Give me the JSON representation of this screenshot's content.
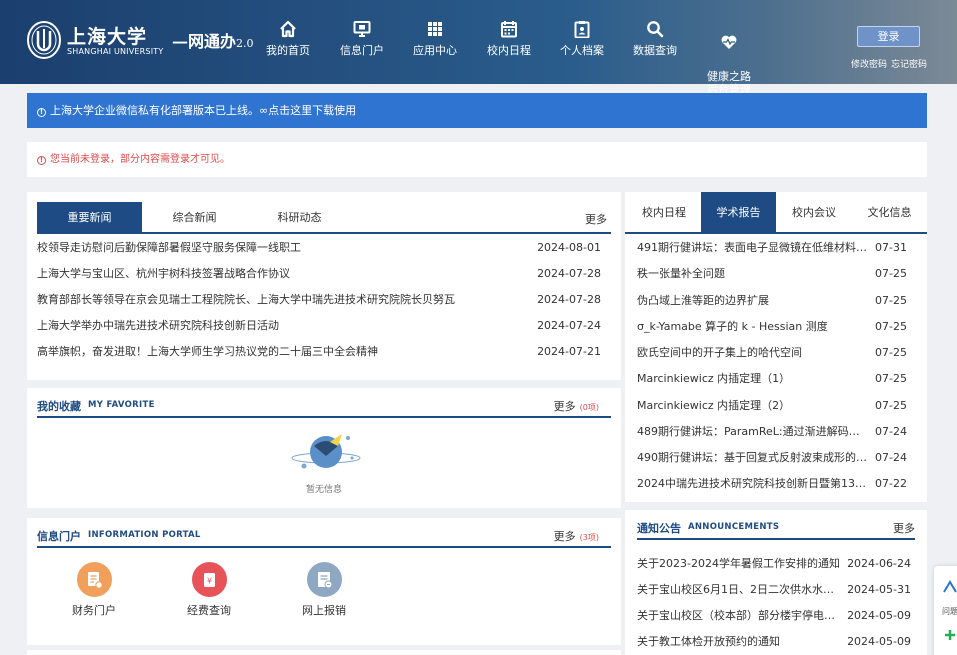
{
  "header": {
    "brand_cn": "上海大学",
    "brand_en": "SHANGHAI UNIVERSITY",
    "brand_sub": "—网通办",
    "brand_ver": "2.0",
    "nav": [
      {
        "label": "我的首页",
        "icon": "home-icon"
      },
      {
        "label": "信息门户",
        "icon": "monitor-icon"
      },
      {
        "label": "应用中心",
        "icon": "grid-icon"
      },
      {
        "label": "校内日程",
        "icon": "calendar-icon"
      },
      {
        "label": "个人档案",
        "icon": "clipboard-icon"
      },
      {
        "label": "数据查询",
        "icon": "search-icon"
      },
      {
        "label": "健康之路\n后台管理",
        "icon": "heart-icon"
      }
    ],
    "login": "登录",
    "change_password": "修改密码",
    "forgot_password": "忘记密码"
  },
  "notices": {
    "blue": "上海大学企业微信私有化部署版本已上线。",
    "blue_link": "点击这里下载使用",
    "red": "您当前未登录，部分内容需登录才可见。"
  },
  "news": {
    "tabs": [
      "重要新闻",
      "综合新闻",
      "科研动态"
    ],
    "more": "更多",
    "items": [
      {
        "title": "校领导走访慰问后勤保障部暑假坚守服务保障一线职工",
        "date": "2024-08-01"
      },
      {
        "title": "上海大学与宝山区、杭州宇树科技签署战略合作协议",
        "date": "2024-07-28"
      },
      {
        "title": "教育部部长等领导在京会见瑞士工程院院长、上海大学中瑞先进技术研究院院长贝努瓦",
        "date": "2024-07-28"
      },
      {
        "title": "上海大学举办中瑞先进技术研究院科技创新日活动",
        "date": "2024-07-24"
      },
      {
        "title": "高举旗帜，奋发进取！上海大学师生学习热议党的二十届三中全会精神",
        "date": "2024-07-21"
      }
    ]
  },
  "favorites": {
    "title": "我的收藏",
    "title_en": "MY FAVORITE",
    "more": "更多",
    "count": "(0项)",
    "empty": "暂无信息"
  },
  "portal": {
    "title": "信息门户",
    "title_en": "INFORMATION PORTAL",
    "more": "更多",
    "count": "(3项)",
    "items": [
      {
        "label": "财务门户",
        "color": "#f0a05a"
      },
      {
        "label": "经费查询",
        "color": "#e8535a"
      },
      {
        "label": "网上报销",
        "color": "#8ea8c3"
      }
    ]
  },
  "right_tabs": {
    "tabs": [
      "校内日程",
      "学术报告",
      "校内会议",
      "文化信息"
    ],
    "active": 1,
    "items": [
      {
        "title": "491期行健讲坛：表面电子显微镜在低维材料的...",
        "date": "07-31"
      },
      {
        "title": "秩一张量补全问题",
        "date": "07-25"
      },
      {
        "title": "伪凸域上淮等距的边界扩展",
        "date": "07-25"
      },
      {
        "title": "σ_k-Yamabe 算子的 k - Hessian 测度",
        "date": "07-25"
      },
      {
        "title": "欧氏空间中的开子集上的哈代空间",
        "date": "07-25"
      },
      {
        "title": "Marcinkiewicz 内插定理（1）",
        "date": "07-25"
      },
      {
        "title": "Marcinkiewicz 内插定理（2）",
        "date": "07-25"
      },
      {
        "title": "489期行健讲坛：ParamReL:通过渐进解码贝叶...",
        "date": "07-24"
      },
      {
        "title": "490期行健讲坛：基于回复式反射波束成形的无...",
        "date": "07-24"
      },
      {
        "title": "2024中瑞先进技术研究院科技创新日暨第13期...",
        "date": "07-22"
      }
    ]
  },
  "announcements": {
    "title": "通知公告",
    "title_en": "ANNOUNCEMENTS",
    "more": "更多",
    "items": [
      {
        "title": "关于2023-2024学年暑假工作安排的通知",
        "date": "2024-06-24"
      },
      {
        "title": "关于宝山校区6月1日、2日二次供水水箱水...",
        "date": "2024-05-31"
      },
      {
        "title": "关于宝山校区（校本部）部分楼宇停电的通知",
        "date": "2024-05-09"
      },
      {
        "title": "关于教工体检开放预约的通知",
        "date": "2024-05-09"
      }
    ]
  },
  "side_float": {
    "label": "问题"
  }
}
